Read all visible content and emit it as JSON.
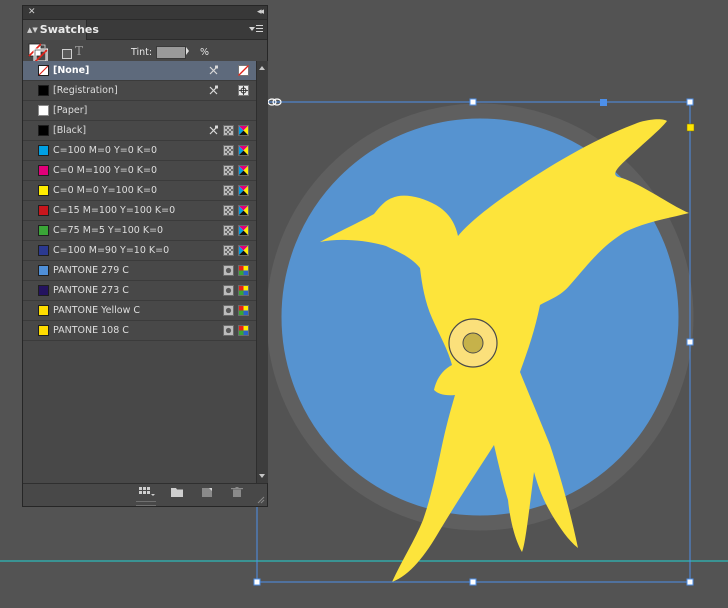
{
  "panel": {
    "tab_title": "Swatches",
    "tint_label": "Tint:",
    "tint_value": "",
    "tint_unit": "%",
    "text_format_icon": "T"
  },
  "swatches": [
    {
      "name": "[None]",
      "color": "none",
      "selected": true,
      "icons": [
        "no-edit-icon",
        "none-color-icon"
      ]
    },
    {
      "name": "[Registration]",
      "color": "#000000",
      "icons": [
        "no-edit-icon",
        "registration-icon"
      ]
    },
    {
      "name": "[Paper]",
      "color": "#ffffff",
      "icons": []
    },
    {
      "name": "[Black]",
      "color": "#000000",
      "icons": [
        "no-edit-icon",
        "process-icon",
        "cmyk-icon"
      ]
    },
    {
      "name": "C=100 M=0 Y=0 K=0",
      "color": "#00a0e3",
      "icons": [
        "process-icon",
        "cmyk-icon"
      ]
    },
    {
      "name": "C=0 M=100 Y=0 K=0",
      "color": "#e2007a",
      "icons": [
        "process-icon",
        "cmyk-icon"
      ]
    },
    {
      "name": "C=0 M=0 Y=100 K=0",
      "color": "#ffed00",
      "icons": [
        "process-icon",
        "cmyk-icon"
      ]
    },
    {
      "name": "C=15 M=100 Y=100 K=0",
      "color": "#c8161d",
      "icons": [
        "process-icon",
        "cmyk-icon"
      ]
    },
    {
      "name": "C=75 M=5 Y=100 K=0",
      "color": "#3aa537",
      "icons": [
        "process-icon",
        "cmyk-icon"
      ]
    },
    {
      "name": "C=100 M=90 Y=10 K=0",
      "color": "#2b3990",
      "icons": [
        "process-icon",
        "cmyk-icon"
      ]
    },
    {
      "name": "PANTONE 279 C",
      "color": "#4f8fd8",
      "icons": [
        "spot-icon",
        "lab-icon"
      ]
    },
    {
      "name": "PANTONE 273 C",
      "color": "#24135f",
      "icons": [
        "spot-icon",
        "lab-icon"
      ]
    },
    {
      "name": "PANTONE Yellow C",
      "color": "#fedd00",
      "icons": [
        "spot-icon",
        "lab-icon"
      ]
    },
    {
      "name": "PANTONE 108 C",
      "color": "#fedb00",
      "icons": [
        "spot-icon",
        "lab-icon"
      ]
    }
  ],
  "colors": {
    "artwork_blue": "#5693d0",
    "artwork_ring": "#5f5f5f",
    "bird_yellow": "#fde43b",
    "selection_blue": "#4d8fe8",
    "guide_cyan": "#22d3d3",
    "panel_bg": "#484848"
  }
}
